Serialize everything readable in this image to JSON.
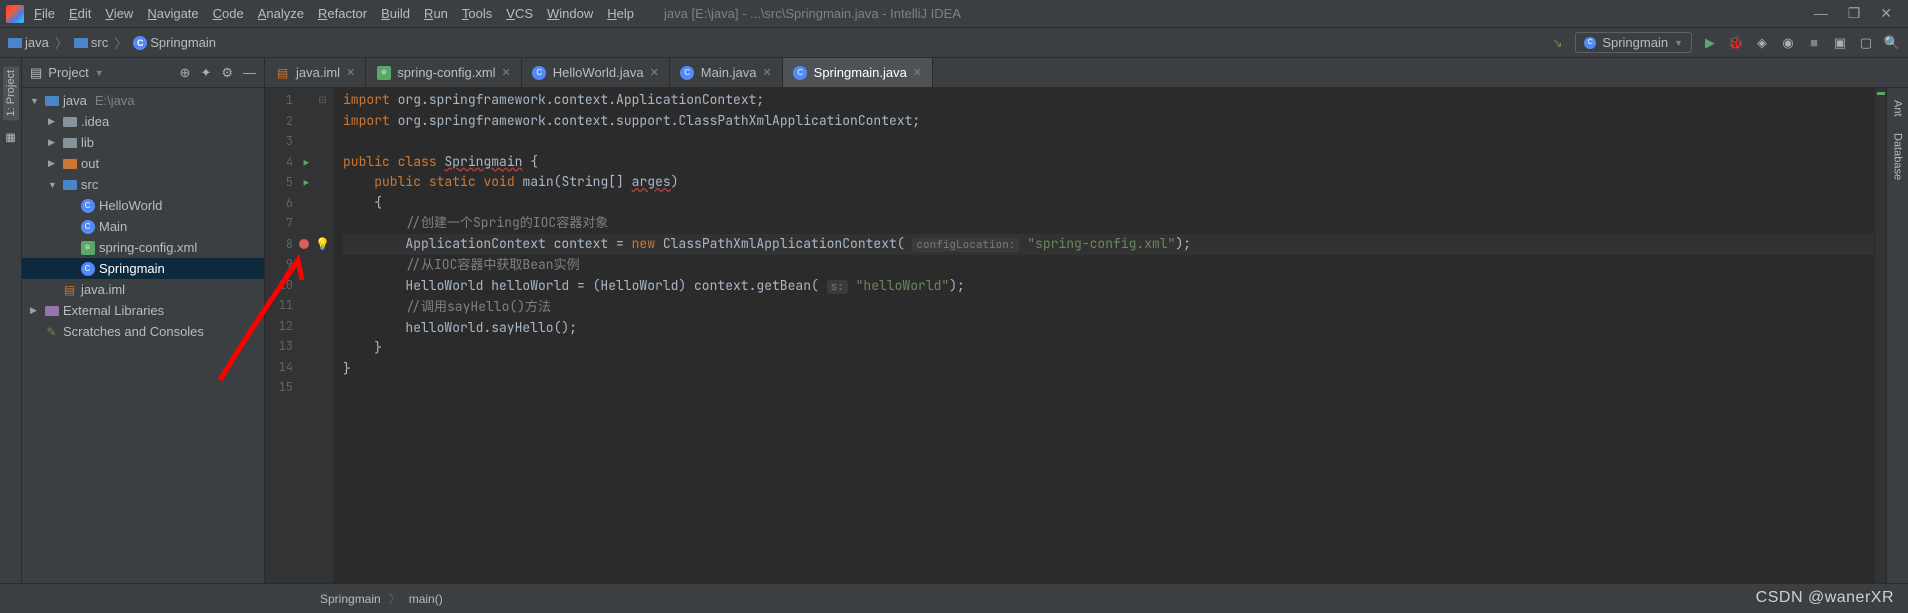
{
  "titlebar": {
    "menus": [
      "File",
      "Edit",
      "View",
      "Navigate",
      "Code",
      "Analyze",
      "Refactor",
      "Build",
      "Run",
      "Tools",
      "VCS",
      "Window",
      "Help"
    ],
    "title": "java [E:\\java] - ...\\src\\Springmain.java - IntelliJ IDEA"
  },
  "breadcrumb": {
    "items": [
      {
        "icon": "folder-blue",
        "label": "java"
      },
      {
        "icon": "folder-blue",
        "label": "src"
      },
      {
        "icon": "class",
        "label": "Springmain"
      }
    ]
  },
  "run_config": {
    "label": "Springmain"
  },
  "project_panel": {
    "title": "Project",
    "tree": [
      {
        "depth": 0,
        "arrow": "open",
        "ico": "folder-blue",
        "label": "java",
        "sub": "E:\\java"
      },
      {
        "depth": 1,
        "arrow": "closed",
        "ico": "folder",
        "label": ".idea"
      },
      {
        "depth": 1,
        "arrow": "closed",
        "ico": "folder",
        "label": "lib"
      },
      {
        "depth": 1,
        "arrow": "closed",
        "ico": "folder-orange",
        "label": "out"
      },
      {
        "depth": 1,
        "arrow": "open",
        "ico": "folder-blue",
        "label": "src"
      },
      {
        "depth": 2,
        "arrow": "none",
        "ico": "class",
        "label": "HelloWorld"
      },
      {
        "depth": 2,
        "arrow": "none",
        "ico": "class-run",
        "label": "Main"
      },
      {
        "depth": 2,
        "arrow": "none",
        "ico": "xml",
        "label": "spring-config.xml"
      },
      {
        "depth": 2,
        "arrow": "none",
        "ico": "class-run",
        "label": "Springmain",
        "sel": true
      },
      {
        "depth": 1,
        "arrow": "none",
        "ico": "iml",
        "label": "java.iml"
      },
      {
        "depth": 0,
        "arrow": "closed",
        "ico": "lib",
        "label": "External Libraries"
      },
      {
        "depth": 0,
        "arrow": "none",
        "ico": "scratch",
        "label": "Scratches and Consoles"
      }
    ]
  },
  "editor_tabs": [
    {
      "ico": "iml",
      "label": "java.iml",
      "active": false
    },
    {
      "ico": "xml",
      "label": "spring-config.xml",
      "active": false
    },
    {
      "ico": "class",
      "label": "HelloWorld.java",
      "active": false
    },
    {
      "ico": "class-run",
      "label": "Main.java",
      "active": false
    },
    {
      "ico": "class-run",
      "label": "Springmain.java",
      "active": true
    }
  ],
  "code_lines": [
    {
      "n": 1,
      "mark": "collapse",
      "html": "<span class='kw'>import</span> org.springframework.context.ApplicationContext;"
    },
    {
      "n": 2,
      "mark": "",
      "html": "<span class='kw'>import</span> org.springframework.context.support.ClassPathXmlApplicationContext;"
    },
    {
      "n": 3,
      "mark": "",
      "html": ""
    },
    {
      "n": 4,
      "mark": "run",
      "html": "<span class='kw'>public</span> <span class='kw'>class</span> <span class='und'>Springmain</span> {"
    },
    {
      "n": 5,
      "mark": "run",
      "html": "    <span class='kw'>public</span> <span class='kw'>static</span> <span class='kw'>void</span> main(String[] <span class='und'>arges</span>)"
    },
    {
      "n": 6,
      "mark": "",
      "html": "    {"
    },
    {
      "n": 7,
      "mark": "",
      "html": "        <span class='cmt'>//创建一个Spring的IOC容器对象</span>"
    },
    {
      "n": 8,
      "mark": "bp",
      "bulb": true,
      "hl": true,
      "html": "        ApplicationContext context = <span class='kw'>new</span> ClassPathXmlApplicationContext( <span class='param-hint'>configLocation:</span> <span class='str'>\"spring-config.xml\"</span>);"
    },
    {
      "n": 9,
      "mark": "",
      "html": "        <span class='cmt'>//从IOC容器中获取Bean实例</span>"
    },
    {
      "n": 10,
      "mark": "",
      "html": "        HelloWorld helloWorld = (HelloWorld) context.getBean( <span class='param-hint'>s:</span> <span class='str'>\"helloWorld\"</span>);"
    },
    {
      "n": 11,
      "mark": "",
      "html": "        <span class='cmt'>//调用sayHello()方法</span>"
    },
    {
      "n": 12,
      "mark": "",
      "html": "        helloWorld.sayHello();"
    },
    {
      "n": 13,
      "mark": "",
      "html": "    }"
    },
    {
      "n": 14,
      "mark": "",
      "html": "}"
    },
    {
      "n": 15,
      "mark": "",
      "html": ""
    }
  ],
  "status_crumb": [
    "Springmain",
    "main()"
  ],
  "watermark": "CSDN @wanerXR",
  "right_tabs": [
    "Ant",
    "Database"
  ],
  "left_tabs": [
    {
      "label": "1: Project",
      "active": true
    },
    {
      "label": "",
      "ico": "structure"
    }
  ]
}
